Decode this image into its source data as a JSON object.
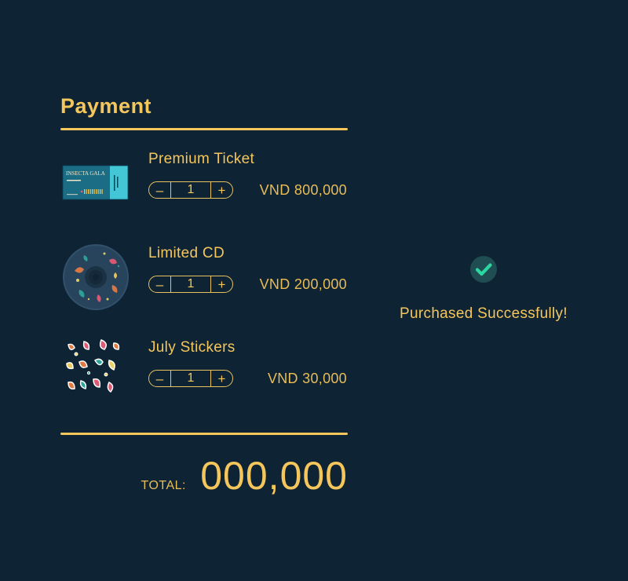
{
  "payment": {
    "title": "Payment",
    "items": [
      {
        "name": "Premium Ticket",
        "quantity": "1",
        "price": "VND 800,000",
        "thumb_icon": "ticket-image",
        "thumb_text": "INSECTA GALA"
      },
      {
        "name": "Limited CD",
        "quantity": "1",
        "price": "VND 200,000",
        "thumb_icon": "cd-image"
      },
      {
        "name": "July Stickers",
        "quantity": "1",
        "price": "VND 30,000",
        "thumb_icon": "stickers-image"
      }
    ],
    "stepper": {
      "minus_label": "–",
      "plus_label": "+"
    },
    "total": {
      "label": "TOTAL:",
      "value": "000,000"
    }
  },
  "success": {
    "message": "Purchased Successfully!",
    "icon": "check-circle-icon"
  },
  "colors": {
    "background": "#0e2334",
    "accent": "#f5c65b",
    "success": "#2bd6a0"
  }
}
